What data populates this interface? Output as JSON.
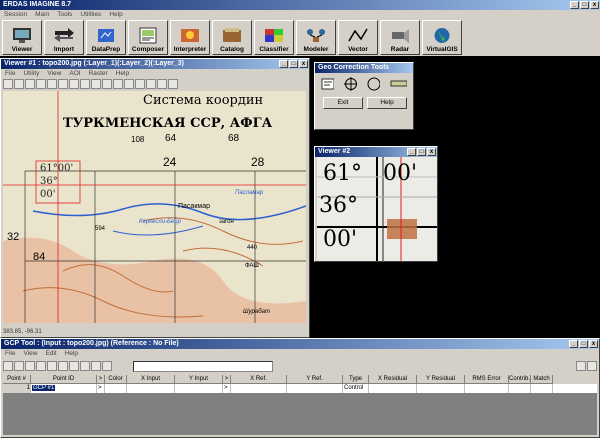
{
  "app": {
    "title": "ERDAS IMAGINE 8.7",
    "menu": [
      "Session",
      "Main",
      "Tools",
      "Utilities",
      "Help"
    ],
    "toolbar": [
      "Viewer",
      "Import",
      "DataPrep",
      "Composer",
      "Interpreter",
      "Catalog",
      "Classifier",
      "Modeler",
      "Vector",
      "Radar",
      "VirtualGIS"
    ]
  },
  "viewer1": {
    "title": "Viewer #1 : topo200.jpg (:Layer_1)(:Layer_2)(:Layer_3)",
    "menu": [
      "File",
      "Utility",
      "View",
      "AOI",
      "Raster",
      "Help"
    ],
    "status": "383.85, -96.31"
  },
  "map": {
    "header1": "Система координ",
    "header2": "ТУРКМЕНСКАЯ ССР, АФГА",
    "grid_top": [
      "108",
      "64",
      "68"
    ],
    "grid_nums": [
      "24",
      "28",
      "32",
      "84"
    ],
    "corner_text": [
      "61°00'",
      "36°",
      "00'"
    ],
    "labels": [
      "Пасакмар",
      "Пасламар",
      "Керкесли-Бейр",
      "загон",
      "594",
      "440",
      "ФАШ",
      "Шурабат"
    ]
  },
  "geo_tools": {
    "title": "Geo Correction Tools",
    "exit": "Exit",
    "help": "Help"
  },
  "viewer2": {
    "title": "Viewer #2",
    "l1a": "61°",
    "l1b": "00'",
    "l2": "36°",
    "l3": "00'"
  },
  "gcp": {
    "title": "GCP Tool : (Input : topo200.jpg) (Reference : No File)",
    "menu": [
      "File",
      "View",
      "Edit",
      "Help"
    ],
    "columns": [
      "Point #",
      "Point ID",
      ">",
      "Color",
      "X Input",
      "Y Input",
      ">",
      "X Ref.",
      "Y Ref.",
      "Type",
      "X Residual",
      "Y Residual",
      "RMS Error",
      "Contrib.",
      "Match"
    ],
    "row": {
      "num": "1",
      "id": "GCP #1",
      "type": "Control"
    }
  },
  "colors": {
    "title_start": "#0a246a",
    "title_end": "#a6caf0",
    "face": "#d4d0c8",
    "paper": "#e9e1c9",
    "red_line": "#e02020"
  }
}
